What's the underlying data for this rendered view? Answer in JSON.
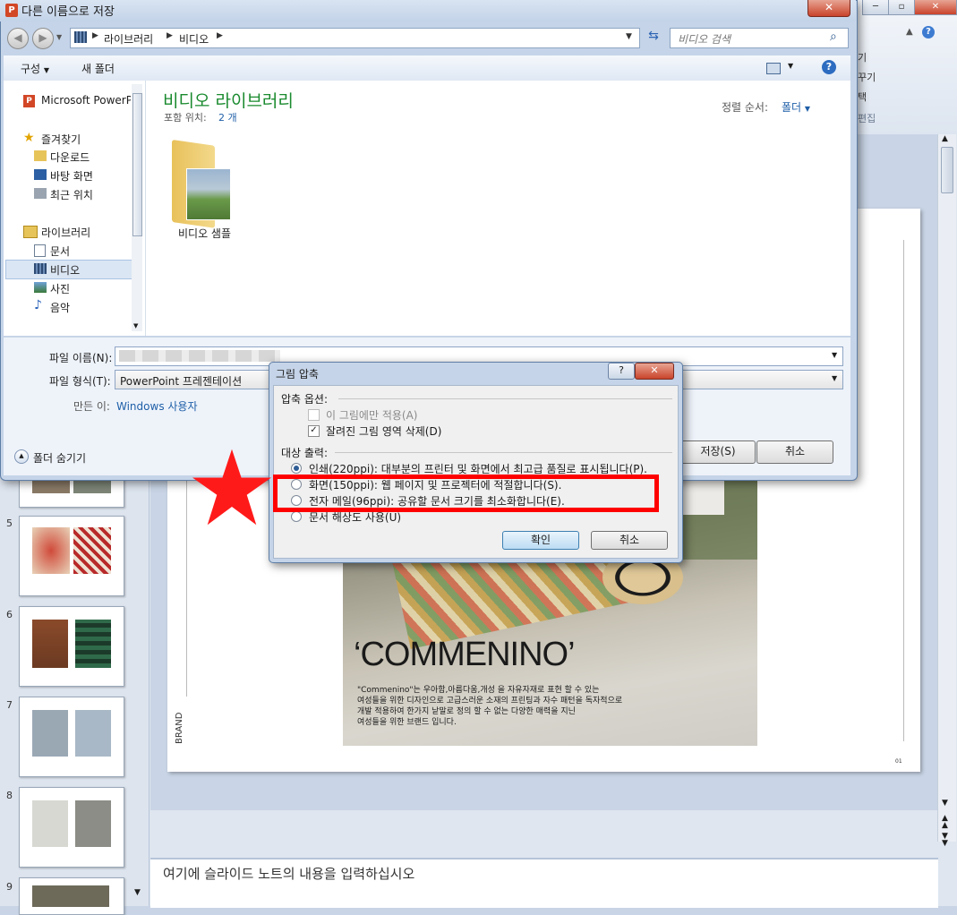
{
  "save_as": {
    "title": "다른 이름으로 저장",
    "breadcrumb": [
      "라이브러리",
      "비디오"
    ],
    "search_placeholder": "비디오 검색",
    "toolbar": {
      "organize": "구성",
      "new_folder": "새 폴더"
    },
    "nav": {
      "top_item": "Microsoft PowerPo",
      "favorites": "즐겨찾기",
      "favorites_items": [
        "다운로드",
        "바탕 화면",
        "최근 위치"
      ],
      "libraries": "라이브러리",
      "library_items": [
        "문서",
        "비디오",
        "사진",
        "음악"
      ]
    },
    "content": {
      "heading": "비디오 라이브러리",
      "includes_label": "포함 위치:",
      "includes_count": "2 개",
      "sort_label": "정렬 순서:",
      "sort_value": "폴더",
      "folder_name": "비디오 샘플"
    },
    "file_name_label": "파일 이름(N):",
    "file_type_label": "파일 형식(T):",
    "file_type_value": "PowerPoint 프레젠테이션",
    "author_label": "만든 이:",
    "author_value": "Windows 사용자",
    "hide_folders": "폴더 숨기기",
    "save_button": "저장(S)",
    "cancel_button": "취소"
  },
  "compress": {
    "title": "그림 압축",
    "help": "?",
    "options_header": "압축 옵션:",
    "apply_only_this": "이 그림에만 적용(A)",
    "delete_cropped": "잘려진 그림 영역 삭제(D)",
    "target_header": "대상 출력:",
    "options": [
      "인쇄(220ppi): 대부분의 프린터 및 화면에서 최고급 품질로 표시됩니다(P).",
      "화면(150ppi): 웹 페이지 및 프로젝터에 적절합니다(S).",
      "전자 메일(96ppi): 공유할 문서 크기를 최소화합니다(E).",
      "문서 해상도 사용(U)"
    ],
    "selected_index": 0,
    "delete_cropped_checked": true,
    "ok_button": "확인",
    "cancel_button": "취소"
  },
  "ribbon": {
    "items": [
      "기",
      "꾸기",
      "택",
      "편집"
    ]
  },
  "slides": {
    "numbers": [
      "5",
      "6",
      "7",
      "8",
      "9"
    ]
  },
  "slide": {
    "brand_title": "‘COMMENINO’",
    "description": [
      "\"Commenino\"는 우아함,아름다움,개성 을 자유자재로 표현 할 수 있는",
      "여성들을 위한 디자인으로 고급스러운 소재의 프린팅과 자수 패턴을 독자적으로",
      "개발 적용하여 한가지 낱말로 정의 할 수 없는 다양한 매력을 지닌",
      "여성들을 위한 브랜드 입니다."
    ],
    "side_label": "BRAND",
    "page_number": "01"
  },
  "notes_placeholder": "여기에 슬라이드 노트의 내용을 입력하십시오",
  "colors": {
    "highlight": "#ff0000",
    "accent": "#1f5fa8",
    "title_blue": "#1a8a2e"
  }
}
